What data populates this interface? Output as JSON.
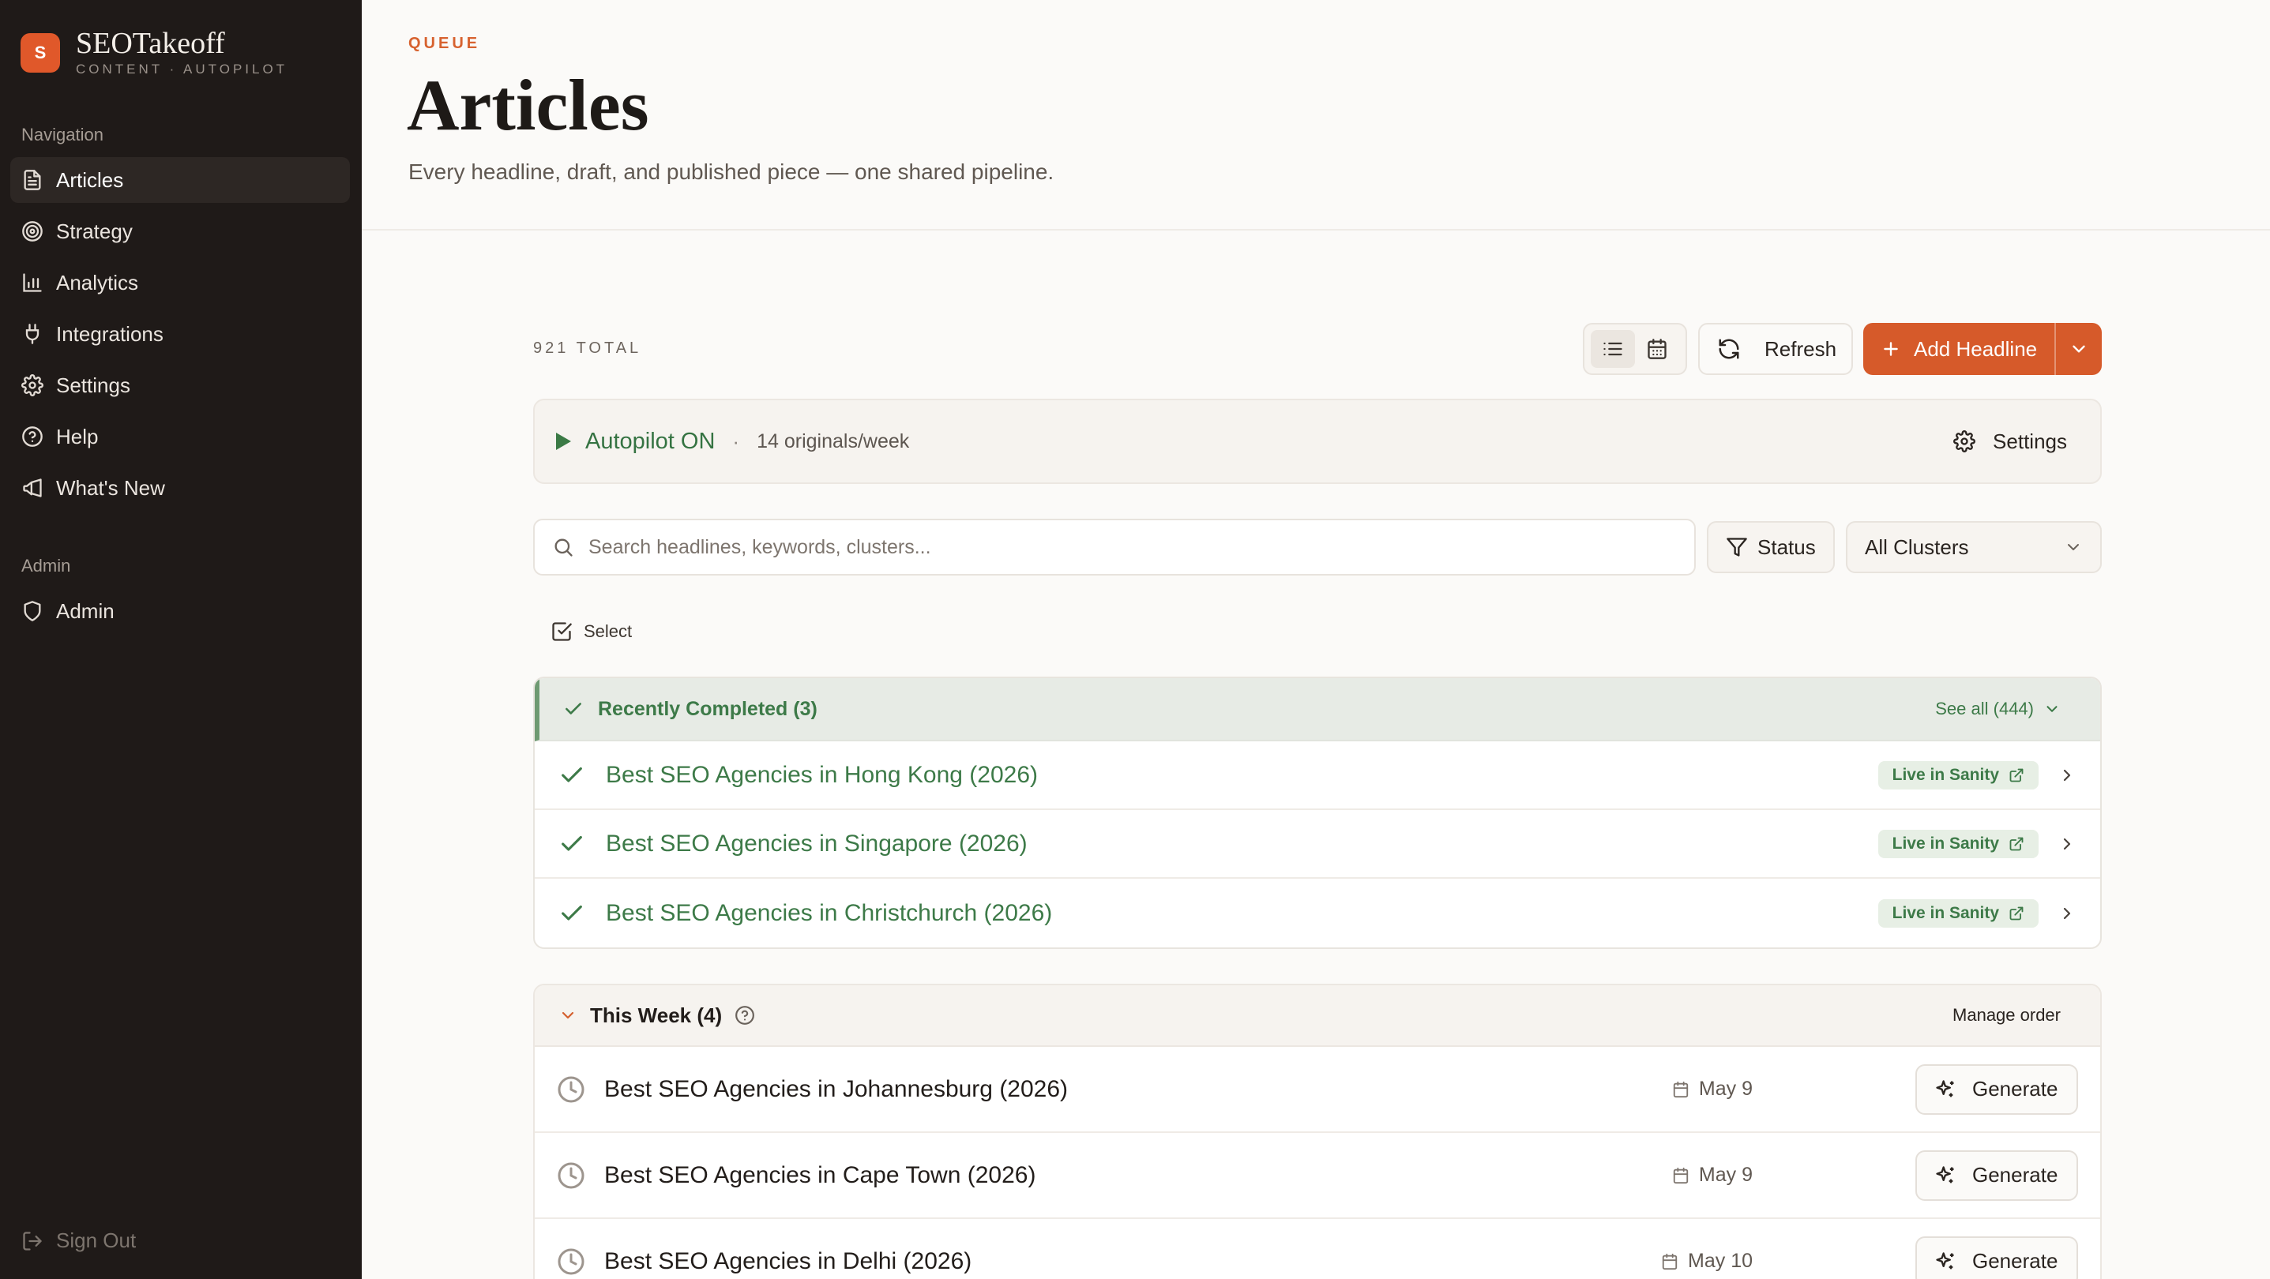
{
  "brand": {
    "logo_letter": "S",
    "name": "SEOTakeoff",
    "tagline": "CONTENT · AUTOPILOT",
    "accent": "#e0582a"
  },
  "sidebar": {
    "nav_heading": "Navigation",
    "items": [
      {
        "label": "Articles",
        "icon": "document-icon",
        "active": true
      },
      {
        "label": "Strategy",
        "icon": "target-icon"
      },
      {
        "label": "Analytics",
        "icon": "bar-chart-icon"
      },
      {
        "label": "Integrations",
        "icon": "plug-icon"
      },
      {
        "label": "Settings",
        "icon": "gear-icon"
      },
      {
        "label": "Help",
        "icon": "help-circle-icon"
      },
      {
        "label": "What's New",
        "icon": "megaphone-icon"
      }
    ],
    "admin_heading": "Admin",
    "admin_items": [
      {
        "label": "Admin",
        "icon": "shield-icon"
      }
    ],
    "sign_out": "Sign Out"
  },
  "header": {
    "eyebrow": "QUEUE",
    "title": "Articles",
    "subtitle": "Every headline, draft, and published piece — one shared pipeline."
  },
  "toolbar": {
    "total": "921 TOTAL",
    "refresh_label": "Refresh",
    "add_label": "Add Headline"
  },
  "autopilot": {
    "label": "Autopilot ON",
    "separator": "·",
    "rate": "14 originals/week",
    "settings_label": "Settings",
    "status_color": "#357342"
  },
  "filters": {
    "search_placeholder": "Search headlines, keywords, clusters...",
    "status_label": "Status",
    "cluster_selected": "All Clusters"
  },
  "select_label": "Select",
  "completed": {
    "title": "Recently Completed (3)",
    "see_all": "See all (444)",
    "items": [
      {
        "title": "Best SEO Agencies in Hong Kong (2026)",
        "badge": "Live in Sanity"
      },
      {
        "title": "Best SEO Agencies in Singapore (2026)",
        "badge": "Live in Sanity"
      },
      {
        "title": "Best SEO Agencies in Christchurch (2026)",
        "badge": "Live in Sanity"
      }
    ]
  },
  "this_week": {
    "title": "This Week (4)",
    "manage": "Manage order",
    "items": [
      {
        "title": "Best SEO Agencies in Johannesburg (2026)",
        "date": "May 9",
        "action": "Generate"
      },
      {
        "title": "Best SEO Agencies in Cape Town (2026)",
        "date": "May 9",
        "action": "Generate"
      },
      {
        "title": "Best SEO Agencies in Delhi (2026)",
        "date": "May 10",
        "action": "Generate"
      }
    ]
  }
}
